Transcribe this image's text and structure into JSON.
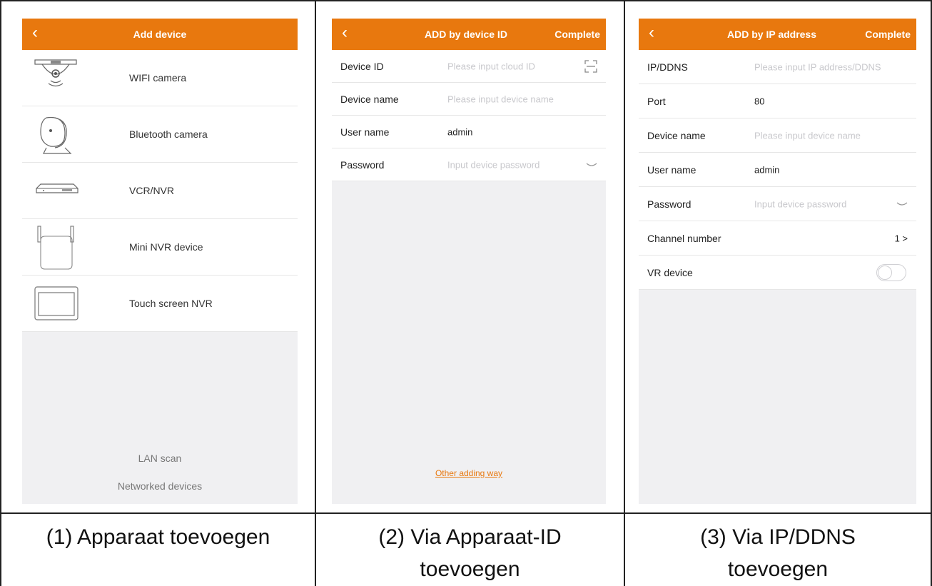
{
  "panel1": {
    "title": "Add device",
    "devices": [
      {
        "label": "WIFI camera",
        "icon": "wifi-camera-icon"
      },
      {
        "label": "Bluetooth camera",
        "icon": "bluetooth-camera-icon"
      },
      {
        "label": "VCR/NVR",
        "icon": "nvr-recorder-icon"
      },
      {
        "label": "Mini NVR device",
        "icon": "mini-nvr-icon"
      },
      {
        "label": "Touch screen NVR",
        "icon": "touch-screen-nvr-icon"
      }
    ],
    "lan_scan": "LAN scan",
    "networked": "Networked devices"
  },
  "panel2": {
    "title": "ADD by device ID",
    "complete": "Complete",
    "fields": [
      {
        "label": "Device ID",
        "placeholder": "Please input cloud ID"
      },
      {
        "label": "Device name",
        "placeholder": "Please input device name"
      },
      {
        "label": "User name",
        "value": "admin"
      },
      {
        "label": "Password",
        "placeholder": "Input device password"
      }
    ],
    "other_way": "Other adding way"
  },
  "panel3": {
    "title": "ADD by IP address",
    "complete": "Complete",
    "fields": [
      {
        "label": "IP/DDNS",
        "placeholder": "Please input IP address/DDNS"
      },
      {
        "label": "Port",
        "value": "80"
      },
      {
        "label": "Device name",
        "placeholder": "Please input device name"
      },
      {
        "label": "User name",
        "value": "admin"
      },
      {
        "label": "Password",
        "placeholder": "Input device password"
      },
      {
        "label": "Channel number",
        "value": "1 >"
      },
      {
        "label": "VR device"
      }
    ]
  },
  "captions": {
    "c1": "(1) Apparaat toevoegen",
    "c2_line1": "(2) Via Apparaat-ID",
    "c2_line2": "toevoegen",
    "c3_line1": "(3) Via IP/DDNS",
    "c3_line2": "toevoegen"
  },
  "colors": {
    "accent": "#e8780e"
  }
}
